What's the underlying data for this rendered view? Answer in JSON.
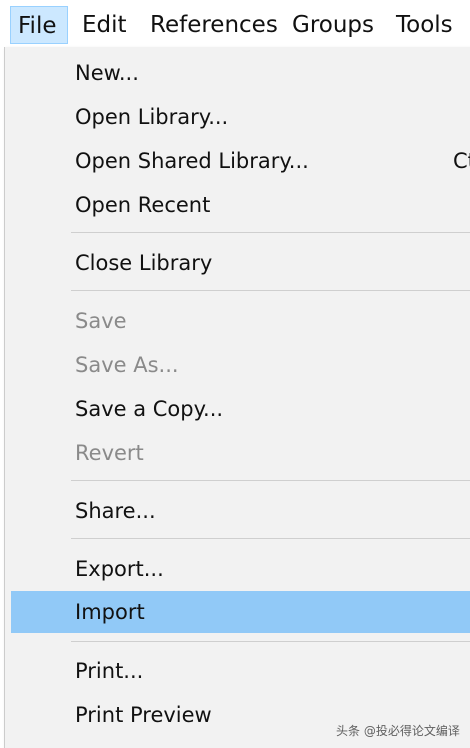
{
  "menubar": {
    "items": [
      "File",
      "Edit",
      "References",
      "Groups",
      "Tools"
    ]
  },
  "file_menu": {
    "new": "New...",
    "open_library": "Open Library...",
    "open_shared_library": "Open Shared Library...",
    "open_shared_library_shortcut": "Ct",
    "open_recent": "Open Recent",
    "close_library": "Close Library",
    "save": "Save",
    "save_as": "Save As...",
    "save_a_copy": "Save a Copy...",
    "revert": "Revert",
    "share": "Share...",
    "export": "Export...",
    "import": "Import",
    "print": "Print...",
    "print_preview": "Print Preview"
  },
  "watermark": "头条 @投必得论文编译",
  "colors": {
    "highlight": "#91c9f7",
    "active_menu": "#cce8ff",
    "disabled_text": "#8a8a8a"
  }
}
